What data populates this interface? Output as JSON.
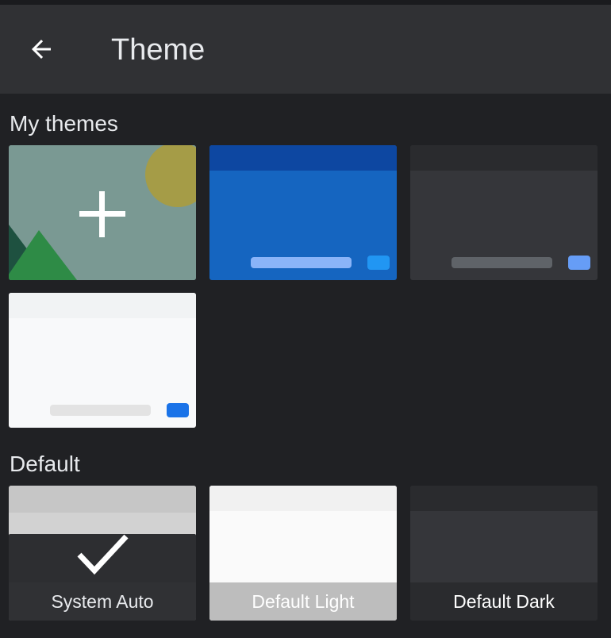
{
  "header": {
    "title": "Theme",
    "back_icon": "arrow-left-icon"
  },
  "my_themes": {
    "label": "My themes",
    "add_icon": "plus-icon",
    "themes": [
      {
        "id": "blue",
        "colors": {
          "bar": "#0d47a1",
          "body": "#1565c0",
          "line": "#8ab4f8",
          "chip": "#2196f3"
        }
      },
      {
        "id": "dark",
        "colors": {
          "bar": "#2a2b2e",
          "body": "#35363a",
          "line": "#5f6368",
          "chip": "#669df6"
        }
      },
      {
        "id": "light",
        "colors": {
          "bar": "#f1f3f4",
          "body": "#f8f9fa",
          "line": "#e3e3e3",
          "chip": "#1a73e8"
        }
      }
    ]
  },
  "default": {
    "label": "Default",
    "options": [
      {
        "label": "System Auto",
        "selected": true
      },
      {
        "label": "Default Light",
        "selected": false
      },
      {
        "label": "Default Dark",
        "selected": false
      }
    ],
    "check_icon": "checkmark-icon"
  }
}
